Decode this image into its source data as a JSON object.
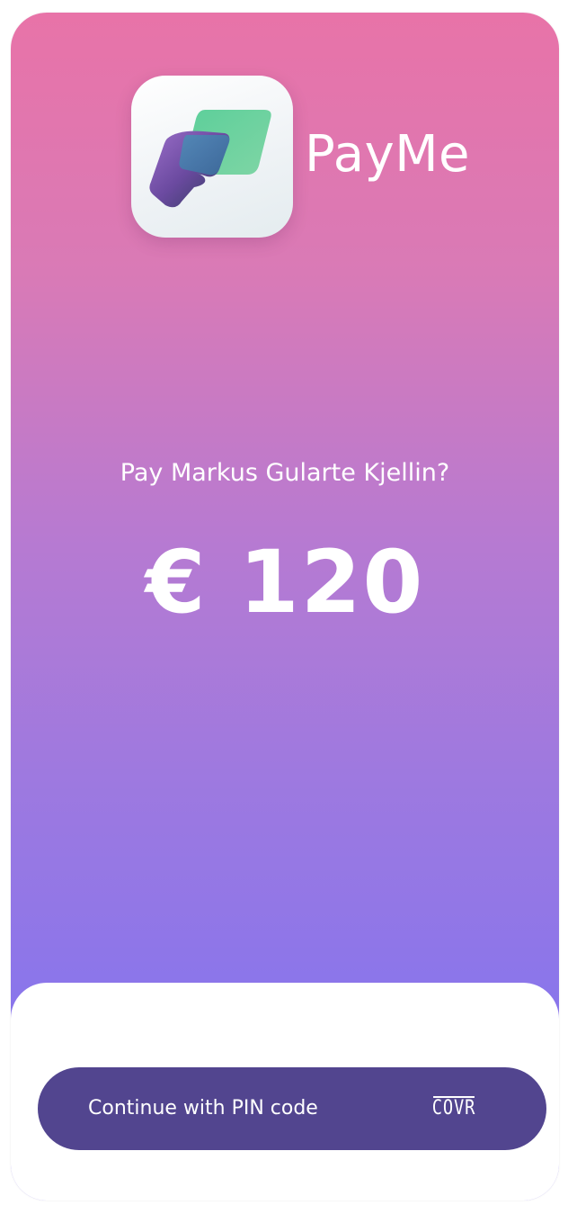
{
  "app": {
    "name": "PayMe"
  },
  "payment": {
    "question": "Pay Markus Gularte Kjellin?",
    "amount": "€ 120"
  },
  "action": {
    "continue_label": "Continue with PIN code",
    "provider_logo_text": "COVR"
  },
  "colors": {
    "gradient_top": "#e873a8",
    "gradient_bottom": "#8571ee",
    "button_bg": "#52458f",
    "text": "#ffffff"
  },
  "icons": {
    "app_icon": "payme-card-hand-icon",
    "provider_logo": "covr-logo"
  }
}
